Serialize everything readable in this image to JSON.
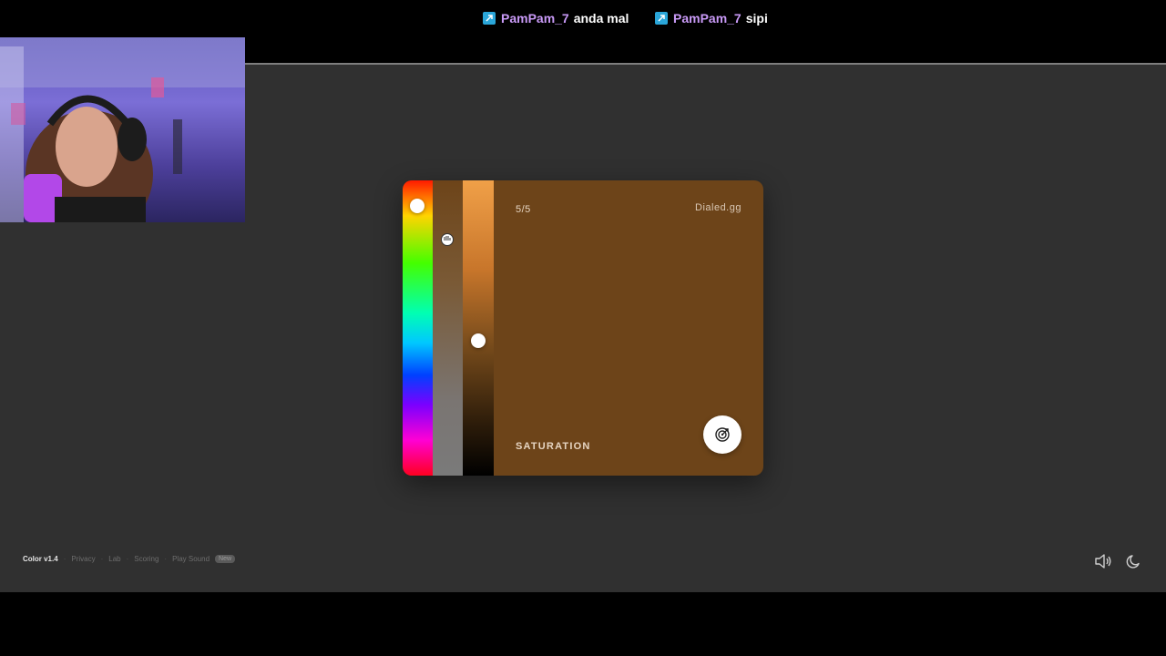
{
  "chat": {
    "messages": [
      {
        "user": "PamPam_7",
        "text": "anda mal"
      },
      {
        "user": "PamPam_7",
        "text": "sipi"
      }
    ]
  },
  "card": {
    "progress": "5/5",
    "brand": "Dialed.gg",
    "mode_label": "SATURATION",
    "color": "#6d4419",
    "hue_level": 0.09,
    "saturation_level": 0.2,
    "lightness_level": 0.54
  },
  "footer": {
    "brand": "Color v1.4",
    "links": [
      "Privacy",
      "Lab",
      "Scoring",
      "Play Sound"
    ],
    "new_badge": "New"
  },
  "icons": {
    "badge": "prime-badge-icon",
    "submit": "target-icon",
    "sound": "speaker-icon",
    "theme": "moon-icon"
  }
}
